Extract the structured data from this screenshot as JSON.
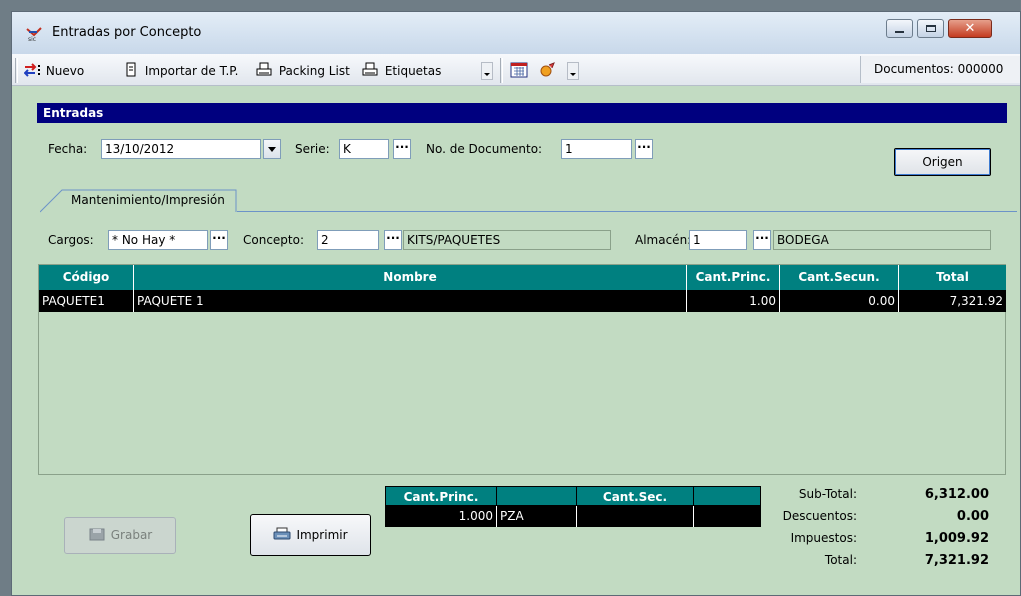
{
  "window": {
    "title": "Entradas por Concepto"
  },
  "toolbar": {
    "nuevo": "Nuevo",
    "importar": "Importar de T.P.",
    "packing": "Packing List",
    "etiquetas": "Etiquetas",
    "documentos": "Documentos: 000000"
  },
  "section": {
    "title": "Entradas"
  },
  "form": {
    "fecha_label": "Fecha:",
    "fecha_value": "13/10/2012",
    "serie_label": "Serie:",
    "serie_value": "K",
    "nodoc_label": "No. de Documento:",
    "nodoc_value": "1",
    "origen_button": "Origen",
    "tab_label": "Mantenimiento/Impresión",
    "cargos_label": "Cargos:",
    "cargos_value": "* No Hay *",
    "concepto_label": "Concepto:",
    "concepto_value": "2",
    "concepto_desc": "KITS/PAQUETES",
    "almacen_label": "Almacén:",
    "almacen_value": "1",
    "almacen_desc": "BODEGA"
  },
  "grid": {
    "headers": [
      "Código",
      "Nombre",
      "Cant.Princ.",
      "Cant.Secun.",
      "Total"
    ],
    "rows": [
      {
        "codigo": "PAQUETE1",
        "nombre": "PAQUETE 1",
        "cant_princ": "1.00",
        "cant_secun": "0.00",
        "total": "7,321.92"
      }
    ]
  },
  "summary_grid": {
    "headers": [
      "Cant.Princ.",
      "",
      "Cant.Sec.",
      ""
    ],
    "row": [
      "1.000",
      "PZA",
      "",
      ""
    ]
  },
  "buttons": {
    "grabar": "Grabar",
    "imprimir": "Imprimir"
  },
  "totals": {
    "subtotal_label": "Sub-Total:",
    "subtotal": "6,312.00",
    "descuentos_label": "Descuentos:",
    "descuentos": "0.00",
    "impuestos_label": "Impuestos:",
    "impuestos": "1,009.92",
    "total_label": "Total:",
    "total": "7,321.92"
  }
}
